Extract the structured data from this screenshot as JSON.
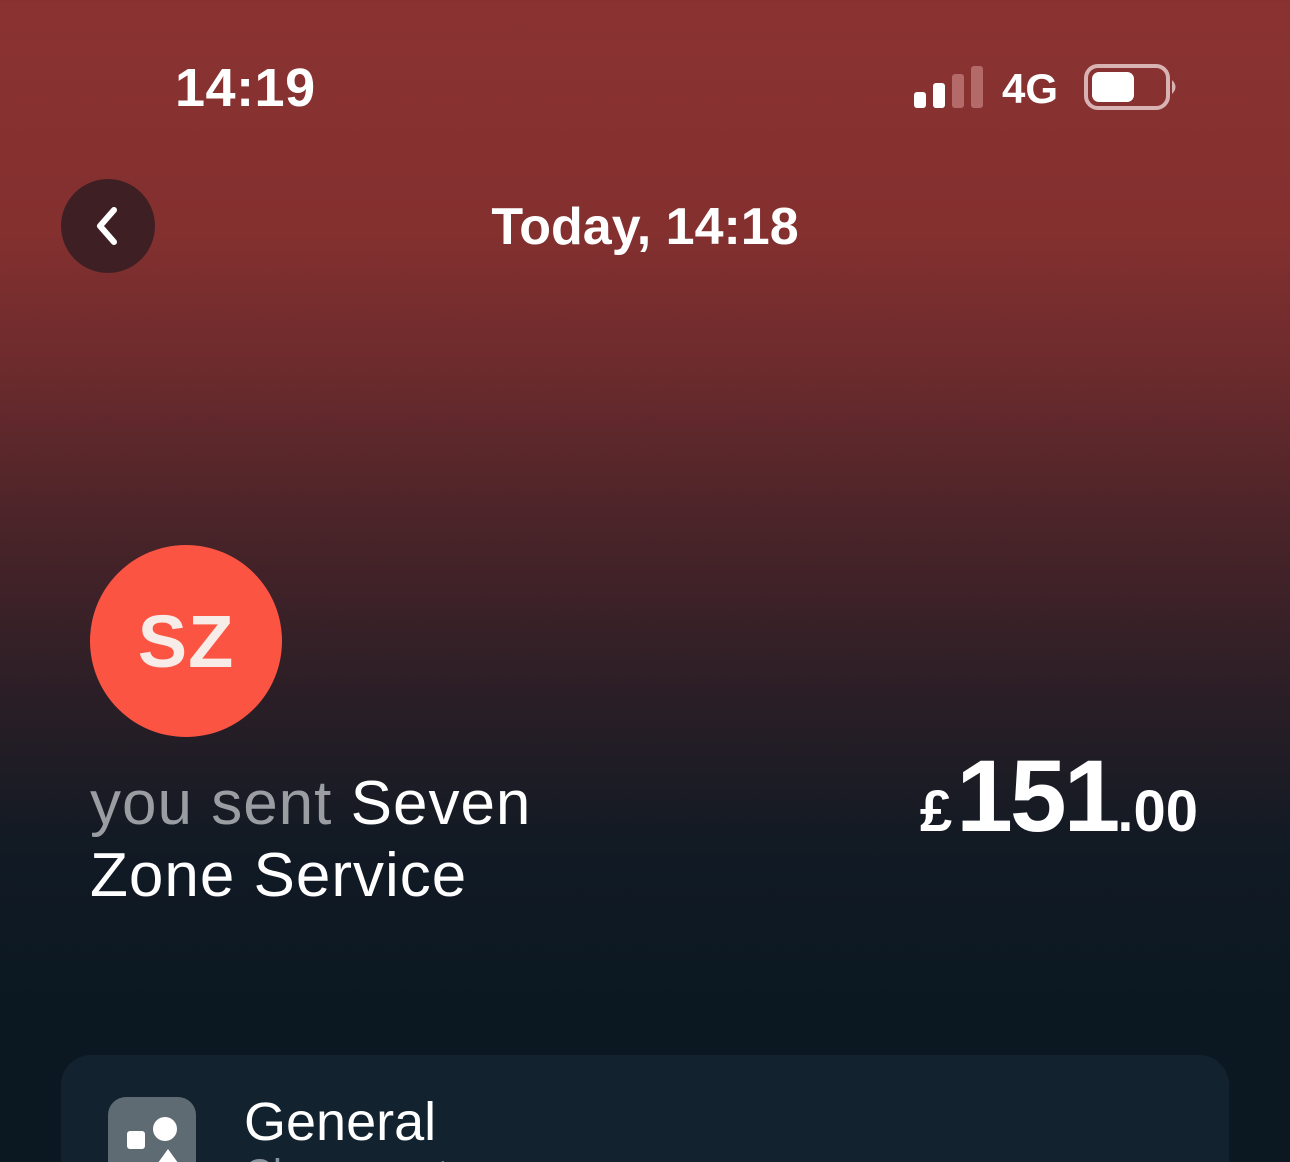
{
  "status_bar": {
    "time": "14:19",
    "network": "4G",
    "signal_bars_active": 2,
    "signal_bars_total": 4,
    "battery_level": 0.6
  },
  "header": {
    "back_icon": "chevron-left-icon",
    "title": "Today, 14:18"
  },
  "transaction": {
    "avatar_initials": "SZ",
    "avatar_color": "#fc5443",
    "direction_text": "you sent ",
    "payee": "Seven Zone Service",
    "amount": {
      "currency": "£",
      "whole": "151",
      "fraction": ".00"
    }
  },
  "category": {
    "icon": "shapes-icon",
    "label": "General",
    "sublabel": "Change category"
  },
  "colors": {
    "header_red": "#8a3232",
    "background_dark": "#0b1822",
    "card_background": "#13222f",
    "muted_text": "#9a9ea3"
  }
}
